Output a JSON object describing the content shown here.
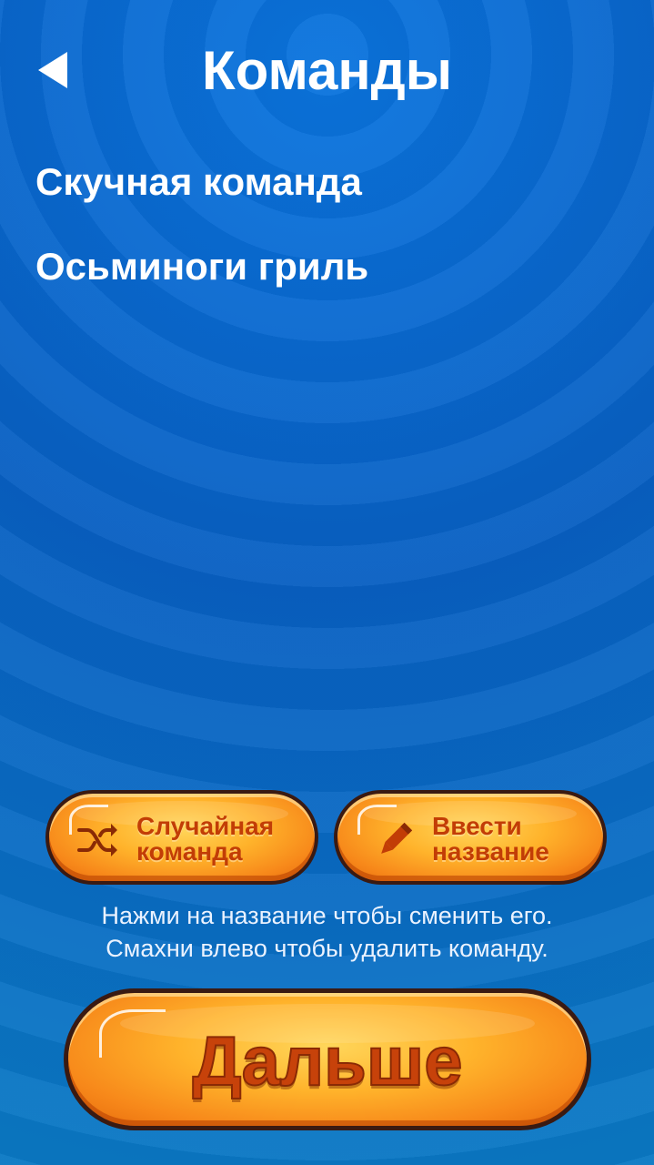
{
  "header": {
    "title": "Команды",
    "back_icon": "back-triangle-icon"
  },
  "teams": [
    {
      "name": "Скучная команда"
    },
    {
      "name": "Осьминоги гриль"
    }
  ],
  "buttons": {
    "random_line1": "Случайная",
    "random_line2": "команда",
    "random_icon": "shuffle-icon",
    "enter_line1": "Ввести",
    "enter_line2": "название",
    "enter_icon": "pencil-icon",
    "next": "Дальше"
  },
  "hint": {
    "line1": "Нажми на название чтобы сменить его.",
    "line2": "Смахни влево чтобы удалить команду."
  },
  "colors": {
    "background": "#085fc2",
    "button_orange": "#ffb32b",
    "button_text": "#c23d06",
    "button_border": "#3a1a12"
  }
}
